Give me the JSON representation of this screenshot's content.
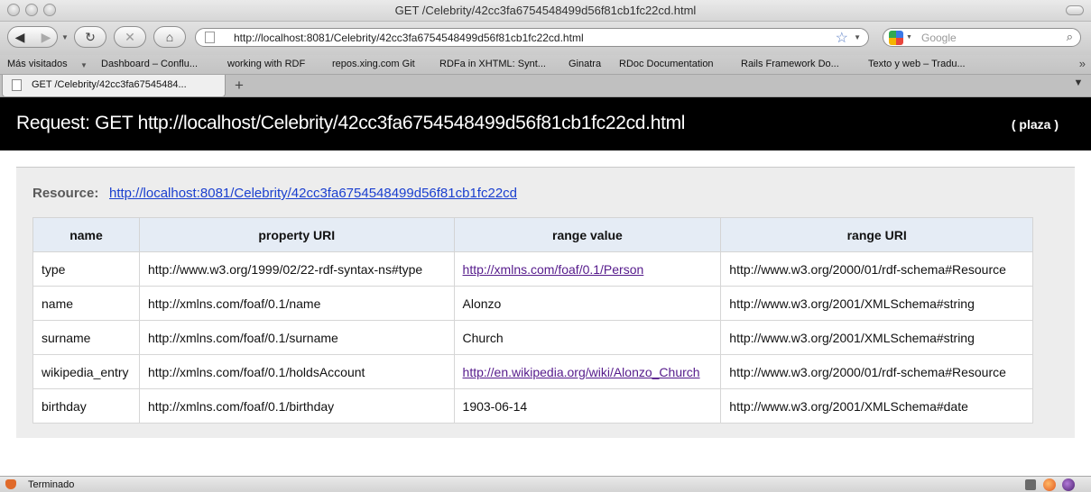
{
  "window": {
    "title": "GET /Celebrity/42cc3fa6754548499d56f81cb1fc22cd.html"
  },
  "toolbar": {
    "back_icon": "arrow-left",
    "forward_icon": "arrow-right",
    "reload_icon": "reload",
    "stop_icon": "x",
    "home_icon": "house",
    "url": "http://localhost:8081/Celebrity/42cc3fa6754548499d56f81cb1fc22cd.html",
    "search_placeholder": "Google"
  },
  "bookmarks": {
    "items": [
      "Más visitados",
      "Dashboard – Conflu...",
      "working with RDF",
      "repos.xing.com Git",
      "RDFa in XHTML: Synt...",
      "Ginatra",
      "RDoc Documentation",
      "Rails Framework Do...",
      "Texto y web – Tradu..."
    ],
    "more": "»"
  },
  "tabs": {
    "items": [
      {
        "label": "GET /Celebrity/42cc3fa67545484..."
      }
    ],
    "new_tab": "+"
  },
  "header": {
    "request_title": "Request: GET http://localhost/Celebrity/42cc3fa6754548499d56f81cb1fc22cd.html",
    "plaza_link": "( plaza )"
  },
  "resource": {
    "label": "Resource:",
    "link": "http://localhost:8081/Celebrity/42cc3fa6754548499d56f81cb1fc22cd"
  },
  "table": {
    "columns": [
      "name",
      "property URI",
      "range value",
      "range URI"
    ],
    "rows": [
      {
        "name": "type",
        "property_uri": "http://www.w3.org/1999/02/22-rdf-syntax-ns#type",
        "range_value": "http://xmlns.com/foaf/0.1/Person",
        "range_uri": "http://www.w3.org/2000/01/rdf-schema#Resource"
      },
      {
        "name": "name",
        "property_uri": "http://xmlns.com/foaf/0.1/name",
        "range_value": "Alonzo",
        "range_uri": "http://www.w3.org/2001/XMLSchema#string"
      },
      {
        "name": "surname",
        "property_uri": "http://xmlns.com/foaf/0.1/surname",
        "range_value": "Church",
        "range_uri": "http://www.w3.org/2001/XMLSchema#string"
      },
      {
        "name": "wikipedia_entry",
        "property_uri": "http://xmlns.com/foaf/0.1/holdsAccount",
        "range_value": "http://en.wikipedia.org/wiki/Alonzo_Church",
        "range_uri": "http://www.w3.org/2000/01/rdf-schema#Resource"
      },
      {
        "name": "birthday",
        "property_uri": "http://xmlns.com/foaf/0.1/birthday",
        "range_value": "1903-06-14",
        "range_uri": "http://www.w3.org/2001/XMLSchema#date"
      }
    ]
  },
  "status": {
    "text": "Terminado"
  }
}
